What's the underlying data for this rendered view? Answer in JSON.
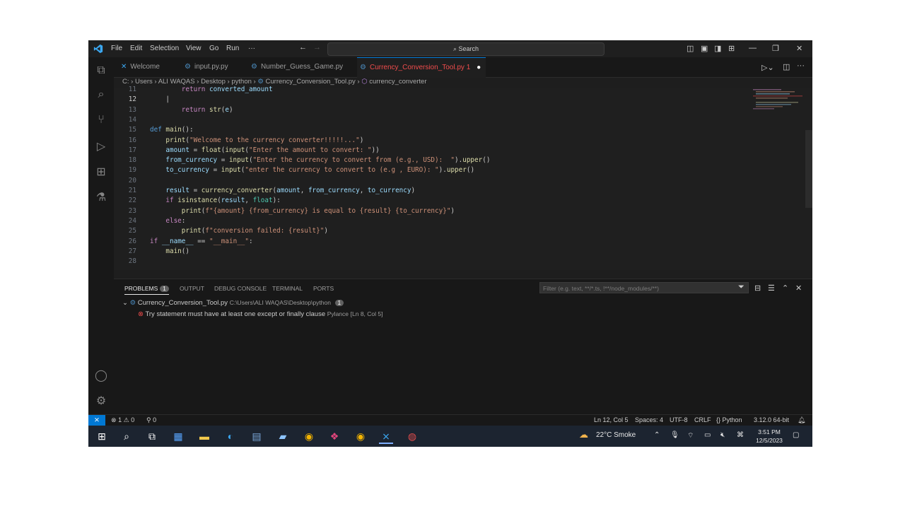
{
  "menu": [
    "File",
    "Edit",
    "Selection",
    "View",
    "Go",
    "Run",
    "···"
  ],
  "search": {
    "label": "Search"
  },
  "tabs": [
    {
      "label": "Welcome",
      "icon": "vscode-icon"
    },
    {
      "label": "input.py.py",
      "icon": "python-icon"
    },
    {
      "label": "Number_Guess_Game.py",
      "icon": "python-icon"
    },
    {
      "label": "Currency_Conversion_Tool.py",
      "badge": "1",
      "modified": true,
      "icon": "python-icon"
    }
  ],
  "breadcrumb": [
    "C:",
    "Users",
    "ALI WAQAS",
    "Desktop",
    "python",
    "Currency_Conversion_Tool.py",
    "currency_converter"
  ],
  "editor": {
    "lines": [
      {
        "n": "11",
        "code": "        return converted_amount"
      },
      {
        "n": "12",
        "code": "    |"
      },
      {
        "n": "13",
        "code": "        return str(e)"
      },
      {
        "n": "14",
        "code": ""
      },
      {
        "n": "15",
        "code": "def main():"
      },
      {
        "n": "16",
        "code": "    print(\"Welcome to the currency converter!!!!!...\")"
      },
      {
        "n": "17",
        "code": "    amount = float(input(\"Enter the amount to convert: \"))"
      },
      {
        "n": "18",
        "code": "    from_currency = input(\"Enter the currency to convert from (e.g., USD):  \").upper()"
      },
      {
        "n": "19",
        "code": "    to_currency = input(\"enter the currency to convert to (e.g , EURO): \").upper()"
      },
      {
        "n": "20",
        "code": ""
      },
      {
        "n": "21",
        "code": "    result = currency_converter(amount, from_currency, to_currency)"
      },
      {
        "n": "22",
        "code": "    if isinstance(result, float):"
      },
      {
        "n": "23",
        "code": "        print(f\"{amount} {from_currency} is equal to {result} {to_currency}\")"
      },
      {
        "n": "24",
        "code": "    else:"
      },
      {
        "n": "25",
        "code": "        print(f\"conversion failed: {result}\")"
      },
      {
        "n": "26",
        "code": "if __name__ == \"__main__\":"
      },
      {
        "n": "27",
        "code": "    main()"
      },
      {
        "n": "28",
        "code": ""
      }
    ]
  },
  "panel": {
    "tabs": [
      "PROBLEMS",
      "OUTPUT",
      "DEBUG CONSOLE",
      "TERMINAL",
      "PORTS"
    ],
    "problems_count": "1",
    "filter_placeholder": "Filter (e.g. text, **/*.ts, !**/node_modules/**)",
    "file": {
      "name": "Currency_Conversion_Tool.py",
      "path": "C:\\Users\\ALI WAQAS\\Desktop\\python",
      "count": "1"
    },
    "problem": {
      "message": "Try statement must have at least one except or finally clause",
      "source": "Pylance",
      "location": "[Ln 8, Col 5]"
    }
  },
  "statusbar": {
    "errors": "1",
    "warnings": "0",
    "ports": "0",
    "position": "Ln 12, Col 5",
    "spaces": "Spaces: 4",
    "encoding": "UTF-8",
    "eol": "CRLF",
    "language": "Python",
    "version": "3.12.0 64-bit"
  },
  "taskbar": {
    "weather": "22°C  Smoke",
    "time": "3:51 PM",
    "date": "12/5/2023"
  },
  "colors": {
    "accent": "#0078d4",
    "error": "#f14c4c",
    "editor_bg": "#1f1f1f"
  }
}
